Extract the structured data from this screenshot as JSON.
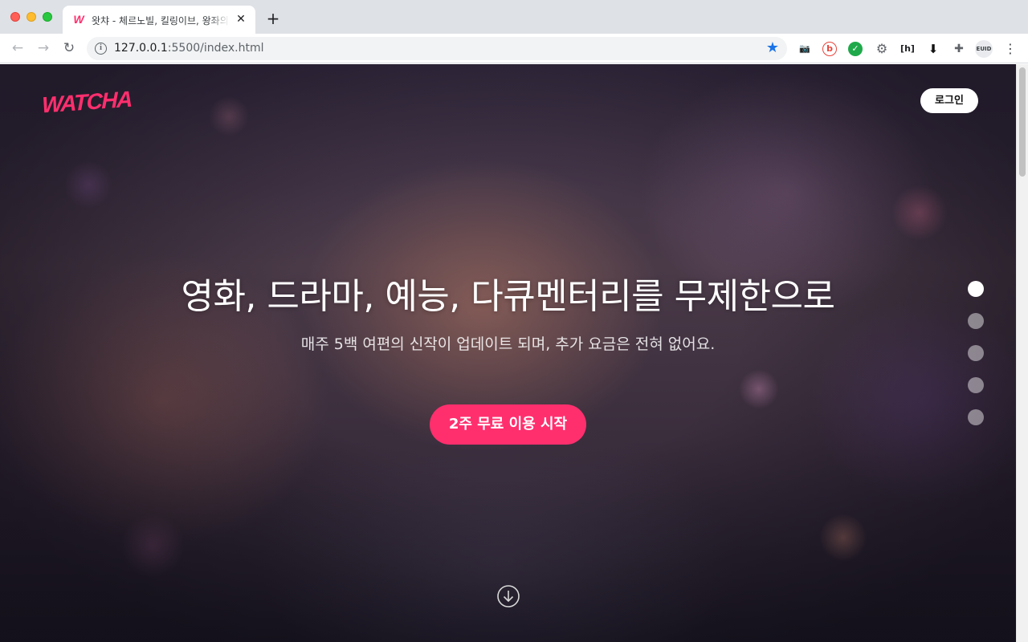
{
  "browser": {
    "tab_title": "왓챠 - 체르노빌, 킬링이브, 왕좌의 게임 등",
    "favicon_letter": "W",
    "tab_close": "✕",
    "new_tab": "+",
    "url_host": "127.0.0.1",
    "url_path": ":5500/index.html",
    "back": "←",
    "forward": "→",
    "reload": "↻",
    "info": "i",
    "star": "★",
    "extensions": [
      {
        "icon": "camera-icon",
        "glyph": "📷"
      },
      {
        "icon": "ext-b-icon",
        "glyph": "b"
      },
      {
        "icon": "shield-check-icon",
        "glyph": "✓"
      },
      {
        "icon": "gear-icon",
        "glyph": "⚙"
      },
      {
        "icon": "bracket-h-icon",
        "glyph": "[h]"
      },
      {
        "icon": "download-icon",
        "glyph": "⬇"
      },
      {
        "icon": "puzzle-icon",
        "glyph": "✚"
      },
      {
        "icon": "euid-icon",
        "glyph": "EUID"
      },
      {
        "icon": "menu-dots-icon",
        "glyph": "⋮"
      }
    ]
  },
  "page": {
    "logo": "WATCHA",
    "login": "로그인",
    "headline": "영화, 드라마, 예능, 다큐멘터리를 무제한으로",
    "subline": "매주 5백 여편의 신작이 업데이트 되며, 추가 요금은 전혀 없어요.",
    "cta": "2주 무료 이용 시작",
    "pager": {
      "count": 5,
      "active": 0
    }
  },
  "colors": {
    "brand": "#ff2f6e",
    "star": "#1a73e8"
  }
}
